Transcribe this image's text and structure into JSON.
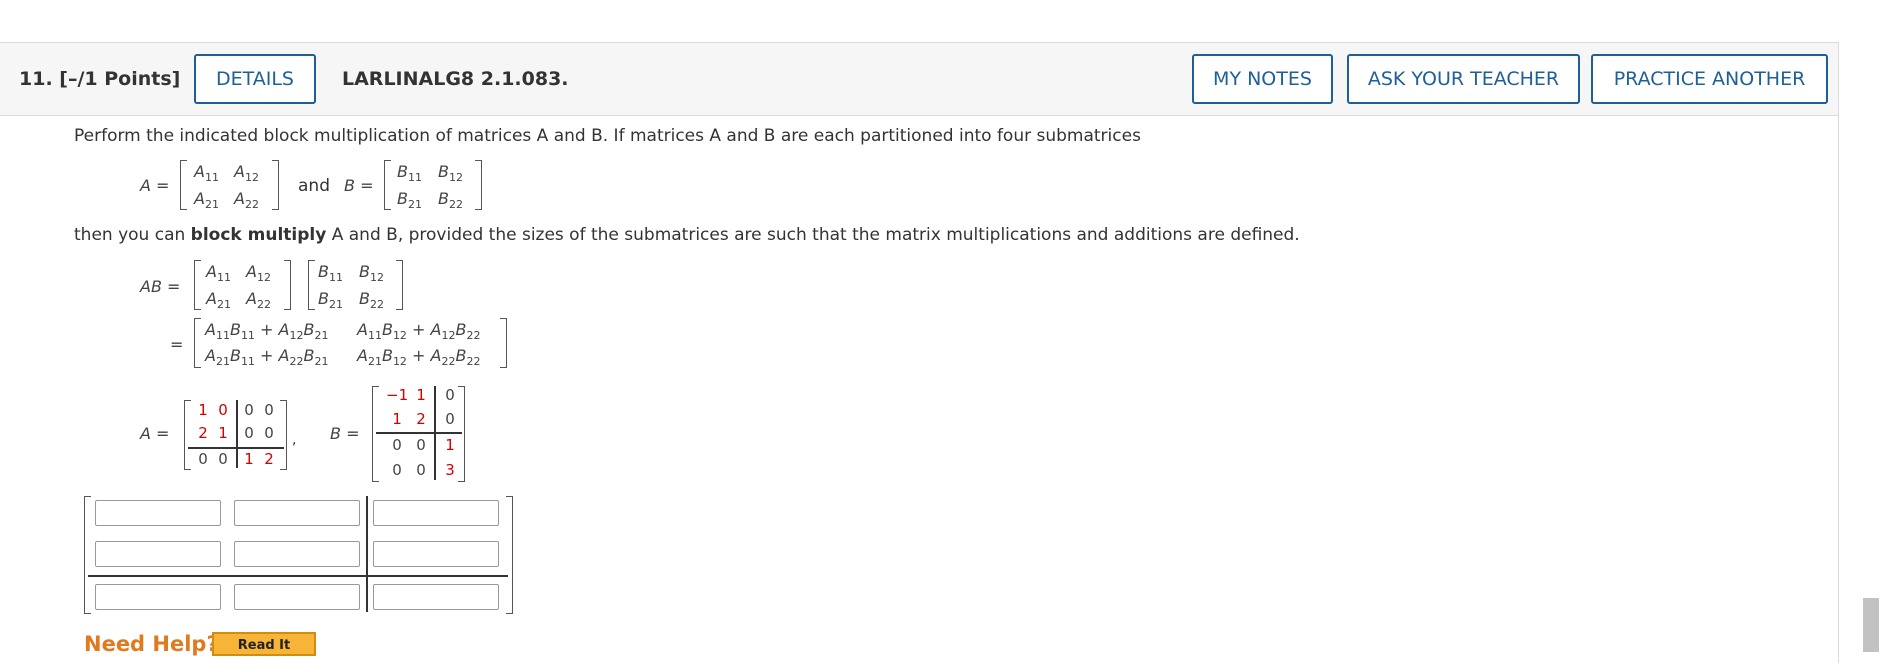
{
  "question": {
    "number_label": "11.  [–/1 Points]",
    "details_label": "DETAILS",
    "code": "LARLINALG8 2.1.083.",
    "my_notes_label": "MY NOTES",
    "ask_teacher_label": "ASK YOUR TEACHER",
    "practice_another_label": "PRACTICE ANOTHER"
  },
  "body": {
    "intro": "Perform the indicated block multiplication of matrices A and B. If matrices A and B are each partitioned into four submatrices",
    "and_word": "and",
    "then_prefix": "then you can ",
    "then_bold": "block multiply",
    "then_suffix": " A and B, provided the sizes of the submatrices are such that the matrix multiplications and additions are defined.",
    "label_A": "A =",
    "label_B": "B =",
    "label_AB": "AB =",
    "label_eq": "="
  },
  "matrix_A_entries": [
    [
      "1",
      "0",
      "0",
      "0"
    ],
    [
      "2",
      "1",
      "0",
      "0"
    ],
    [
      "0",
      "0",
      "1",
      "2"
    ]
  ],
  "matrix_B_entries": [
    [
      "−1",
      "1",
      "0"
    ],
    [
      "1",
      "2",
      "0"
    ],
    [
      "0",
      "0",
      "1"
    ],
    [
      "0",
      "0",
      "3"
    ]
  ],
  "answer": {
    "rows": 3,
    "cols": 3,
    "values": [
      [
        "",
        "",
        ""
      ],
      [
        "",
        "",
        ""
      ],
      [
        "",
        "",
        ""
      ]
    ]
  },
  "help": {
    "need_help_label": "Need Help?",
    "read_it_label": "Read It"
  },
  "colors": {
    "accent": "#1d5f99",
    "red_entries": "#d40000",
    "need_help": "#e07a1f",
    "read_it_bg": "#f7b538"
  }
}
